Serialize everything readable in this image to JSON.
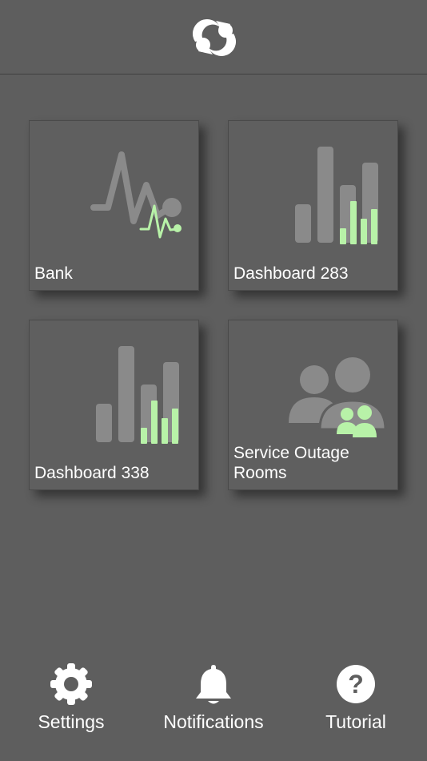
{
  "header": {
    "logo_icon": "sync-arrows-logo"
  },
  "tiles": [
    {
      "label": "Bank",
      "icon": "heartbeat-pulse-icon"
    },
    {
      "label": "Dashboard 283",
      "icon": "bar-chart-icon"
    },
    {
      "label": "Dashboard 338",
      "icon": "bar-chart-icon"
    },
    {
      "label": "Service Outage\nRooms",
      "icon": "people-group-icon"
    }
  ],
  "bottom_nav": [
    {
      "label": "Settings",
      "icon": "gear-icon"
    },
    {
      "label": "Notifications",
      "icon": "bell-icon"
    },
    {
      "label": "Tutorial",
      "icon": "question-mark-icon"
    }
  ],
  "colors": {
    "background": "#5e5e5e",
    "art_gray": "#8a8a8a",
    "accent_green": "#b8f2a8"
  }
}
